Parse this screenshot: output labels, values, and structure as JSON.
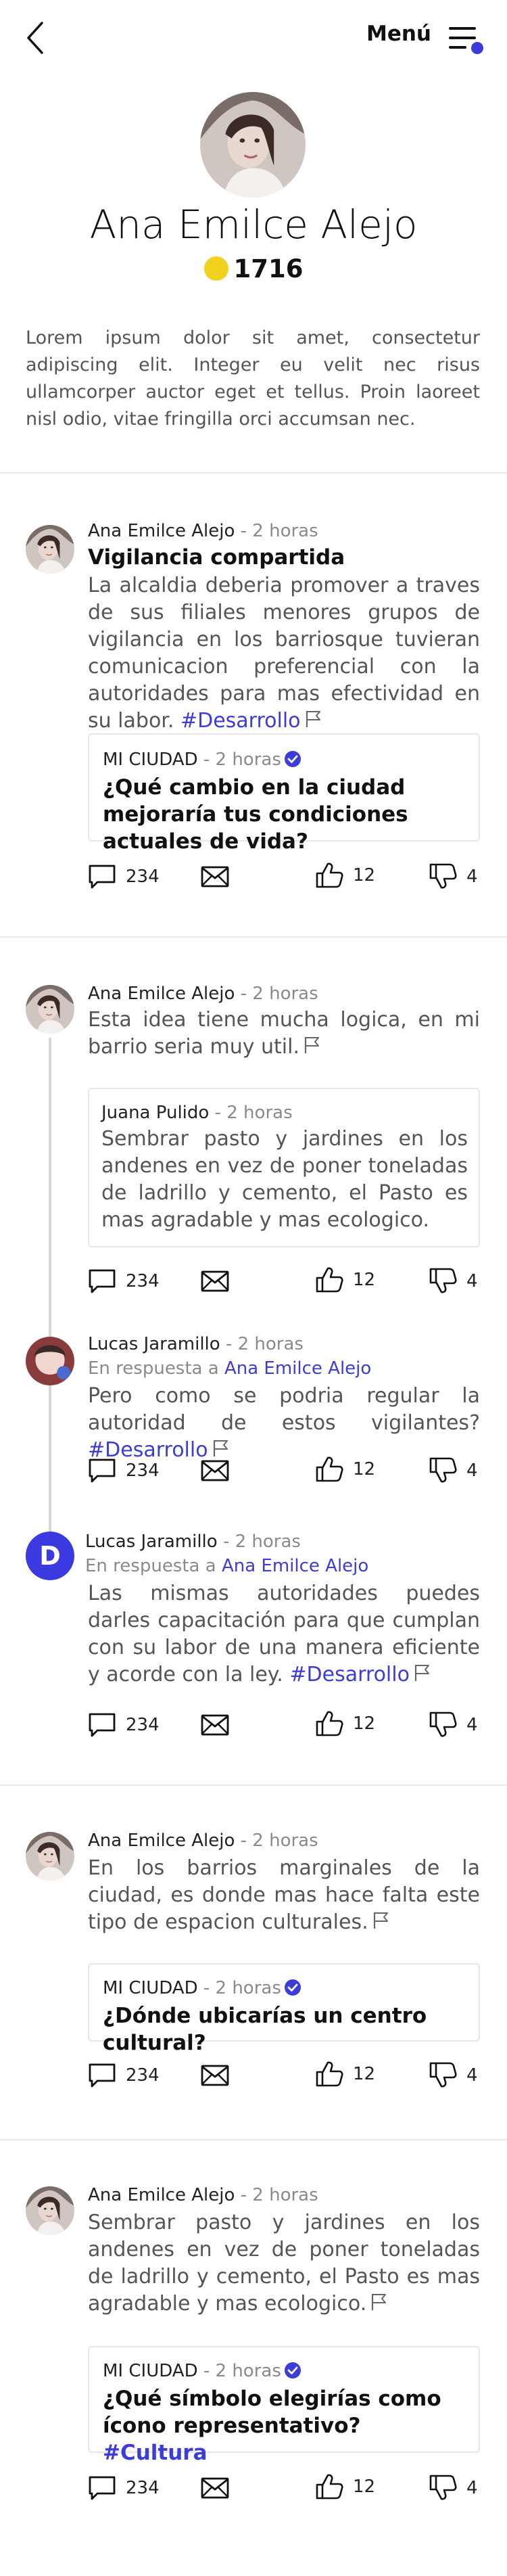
{
  "header": {
    "menu_label": "Menú",
    "accent": "#3c3cd8"
  },
  "profile": {
    "name": "Ana Emilce Alejo",
    "points": "1716",
    "coin_color": "#f3d21e",
    "bio": "Lorem ipsum dolor sit amet, consectetur adipiscing elit. Integer eu velit nec risus ullamcorper auctor eget et tellus. Proin laoreet nisl odio, vitae fringilla orci accumsan nec."
  },
  "sep": " - ",
  "posts": [
    {
      "author": "Ana Emilce Alejo",
      "time": "2 horas",
      "title": "Vigilancia compartida",
      "body": "La alcaldia deberia promover a traves de sus filiales menores grupos de vigilancia en los barriosque tuvieran comunicacion preferencial con la autoridades para mas efectividad en su labor.",
      "hashtag": "#Desarrollo",
      "quote": {
        "source": "MI CIUDAD",
        "time": "2 horas",
        "title": "¿Qué cambio en la ciudad mejoraría tus condiciones actuales de vida?"
      },
      "actions": {
        "comments": "234",
        "likes": "12",
        "dislikes": "4"
      }
    },
    {
      "author": "Ana Emilce Alejo",
      "time": "2 horas",
      "body": "Esta idea tiene mucha logica, en mi barrio seria muy util.",
      "quote": {
        "author": "Juana Pulido",
        "time": "2 horas",
        "body": "Sembrar pasto y jardines en los andenes en vez de poner toneladas de ladrillo y cemento, el Pasto es mas agradable y mas ecologico."
      },
      "actions": {
        "comments": "234",
        "likes": "12",
        "dislikes": "4"
      },
      "replies": [
        {
          "author": "Lucas Jaramillo",
          "time": "2 horas",
          "reply_prefix": "En respuesta a",
          "reply_to": "Ana Emilce Alejo",
          "body": "Pero como se podria regular la autoridad de estos vigilantes?",
          "hashtag": "#Desarrollo",
          "actions": {
            "comments": "234",
            "likes": "12",
            "dislikes": "4"
          }
        },
        {
          "author": "Lucas Jaramillo",
          "initial": "D",
          "time": "2 horas",
          "reply_prefix": "En respuesta a",
          "reply_to": "Ana Emilce Alejo",
          "body": "Las mismas autoridades puedes darles capacitación para que cumplan con su labor de una manera eficiente y acorde con la ley.",
          "hashtag": "#Desarrollo",
          "actions": {
            "comments": "234",
            "likes": "12",
            "dislikes": "4"
          }
        }
      ]
    },
    {
      "author": "Ana Emilce Alejo",
      "time": "2 horas",
      "body": "En los barrios marginales de la ciudad, es donde mas hace falta este tipo de espacion culturales.",
      "quote": {
        "source": "MI CIUDAD",
        "time": "2 horas",
        "title": "¿Dónde ubicarías un centro cultural?"
      },
      "actions": {
        "comments": "234",
        "likes": "12",
        "dislikes": "4"
      }
    },
    {
      "author": "Ana Emilce Alejo",
      "time": "2 horas",
      "body": "Sembrar pasto y jardines en los andenes en vez de poner toneladas de ladrillo y cemento, el Pasto es mas agradable y mas ecologico.",
      "quote": {
        "source": "MI CIUDAD",
        "time": "2 horas",
        "title": "¿Qué símbolo elegirías como ícono representativo?",
        "hashtag": "#Cultura"
      },
      "actions": {
        "comments": "234",
        "likes": "12",
        "dislikes": "4"
      }
    }
  ]
}
